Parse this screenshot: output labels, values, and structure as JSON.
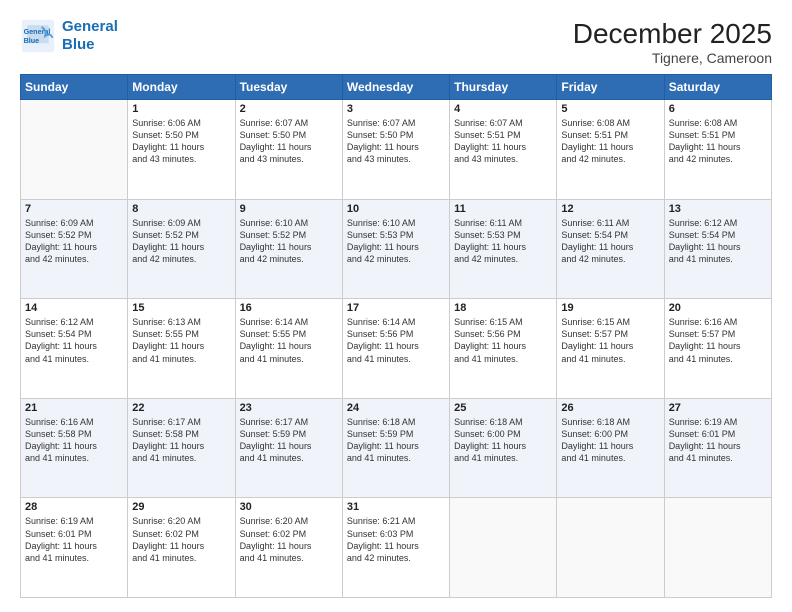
{
  "header": {
    "logo_line1": "General",
    "logo_line2": "Blue",
    "title": "December 2025",
    "subtitle": "Tignere, Cameroon"
  },
  "columns": [
    "Sunday",
    "Monday",
    "Tuesday",
    "Wednesday",
    "Thursday",
    "Friday",
    "Saturday"
  ],
  "weeks": [
    [
      {
        "day": "",
        "info": ""
      },
      {
        "day": "1",
        "info": "Sunrise: 6:06 AM\nSunset: 5:50 PM\nDaylight: 11 hours\nand 43 minutes."
      },
      {
        "day": "2",
        "info": "Sunrise: 6:07 AM\nSunset: 5:50 PM\nDaylight: 11 hours\nand 43 minutes."
      },
      {
        "day": "3",
        "info": "Sunrise: 6:07 AM\nSunset: 5:50 PM\nDaylight: 11 hours\nand 43 minutes."
      },
      {
        "day": "4",
        "info": "Sunrise: 6:07 AM\nSunset: 5:51 PM\nDaylight: 11 hours\nand 43 minutes."
      },
      {
        "day": "5",
        "info": "Sunrise: 6:08 AM\nSunset: 5:51 PM\nDaylight: 11 hours\nand 42 minutes."
      },
      {
        "day": "6",
        "info": "Sunrise: 6:08 AM\nSunset: 5:51 PM\nDaylight: 11 hours\nand 42 minutes."
      }
    ],
    [
      {
        "day": "7",
        "info": "Sunrise: 6:09 AM\nSunset: 5:52 PM\nDaylight: 11 hours\nand 42 minutes."
      },
      {
        "day": "8",
        "info": "Sunrise: 6:09 AM\nSunset: 5:52 PM\nDaylight: 11 hours\nand 42 minutes."
      },
      {
        "day": "9",
        "info": "Sunrise: 6:10 AM\nSunset: 5:52 PM\nDaylight: 11 hours\nand 42 minutes."
      },
      {
        "day": "10",
        "info": "Sunrise: 6:10 AM\nSunset: 5:53 PM\nDaylight: 11 hours\nand 42 minutes."
      },
      {
        "day": "11",
        "info": "Sunrise: 6:11 AM\nSunset: 5:53 PM\nDaylight: 11 hours\nand 42 minutes."
      },
      {
        "day": "12",
        "info": "Sunrise: 6:11 AM\nSunset: 5:54 PM\nDaylight: 11 hours\nand 42 minutes."
      },
      {
        "day": "13",
        "info": "Sunrise: 6:12 AM\nSunset: 5:54 PM\nDaylight: 11 hours\nand 41 minutes."
      }
    ],
    [
      {
        "day": "14",
        "info": "Sunrise: 6:12 AM\nSunset: 5:54 PM\nDaylight: 11 hours\nand 41 minutes."
      },
      {
        "day": "15",
        "info": "Sunrise: 6:13 AM\nSunset: 5:55 PM\nDaylight: 11 hours\nand 41 minutes."
      },
      {
        "day": "16",
        "info": "Sunrise: 6:14 AM\nSunset: 5:55 PM\nDaylight: 11 hours\nand 41 minutes."
      },
      {
        "day": "17",
        "info": "Sunrise: 6:14 AM\nSunset: 5:56 PM\nDaylight: 11 hours\nand 41 minutes."
      },
      {
        "day": "18",
        "info": "Sunrise: 6:15 AM\nSunset: 5:56 PM\nDaylight: 11 hours\nand 41 minutes."
      },
      {
        "day": "19",
        "info": "Sunrise: 6:15 AM\nSunset: 5:57 PM\nDaylight: 11 hours\nand 41 minutes."
      },
      {
        "day": "20",
        "info": "Sunrise: 6:16 AM\nSunset: 5:57 PM\nDaylight: 11 hours\nand 41 minutes."
      }
    ],
    [
      {
        "day": "21",
        "info": "Sunrise: 6:16 AM\nSunset: 5:58 PM\nDaylight: 11 hours\nand 41 minutes."
      },
      {
        "day": "22",
        "info": "Sunrise: 6:17 AM\nSunset: 5:58 PM\nDaylight: 11 hours\nand 41 minutes."
      },
      {
        "day": "23",
        "info": "Sunrise: 6:17 AM\nSunset: 5:59 PM\nDaylight: 11 hours\nand 41 minutes."
      },
      {
        "day": "24",
        "info": "Sunrise: 6:18 AM\nSunset: 5:59 PM\nDaylight: 11 hours\nand 41 minutes."
      },
      {
        "day": "25",
        "info": "Sunrise: 6:18 AM\nSunset: 6:00 PM\nDaylight: 11 hours\nand 41 minutes."
      },
      {
        "day": "26",
        "info": "Sunrise: 6:18 AM\nSunset: 6:00 PM\nDaylight: 11 hours\nand 41 minutes."
      },
      {
        "day": "27",
        "info": "Sunrise: 6:19 AM\nSunset: 6:01 PM\nDaylight: 11 hours\nand 41 minutes."
      }
    ],
    [
      {
        "day": "28",
        "info": "Sunrise: 6:19 AM\nSunset: 6:01 PM\nDaylight: 11 hours\nand 41 minutes."
      },
      {
        "day": "29",
        "info": "Sunrise: 6:20 AM\nSunset: 6:02 PM\nDaylight: 11 hours\nand 41 minutes."
      },
      {
        "day": "30",
        "info": "Sunrise: 6:20 AM\nSunset: 6:02 PM\nDaylight: 11 hours\nand 41 minutes."
      },
      {
        "day": "31",
        "info": "Sunrise: 6:21 AM\nSunset: 6:03 PM\nDaylight: 11 hours\nand 42 minutes."
      },
      {
        "day": "",
        "info": ""
      },
      {
        "day": "",
        "info": ""
      },
      {
        "day": "",
        "info": ""
      }
    ]
  ]
}
